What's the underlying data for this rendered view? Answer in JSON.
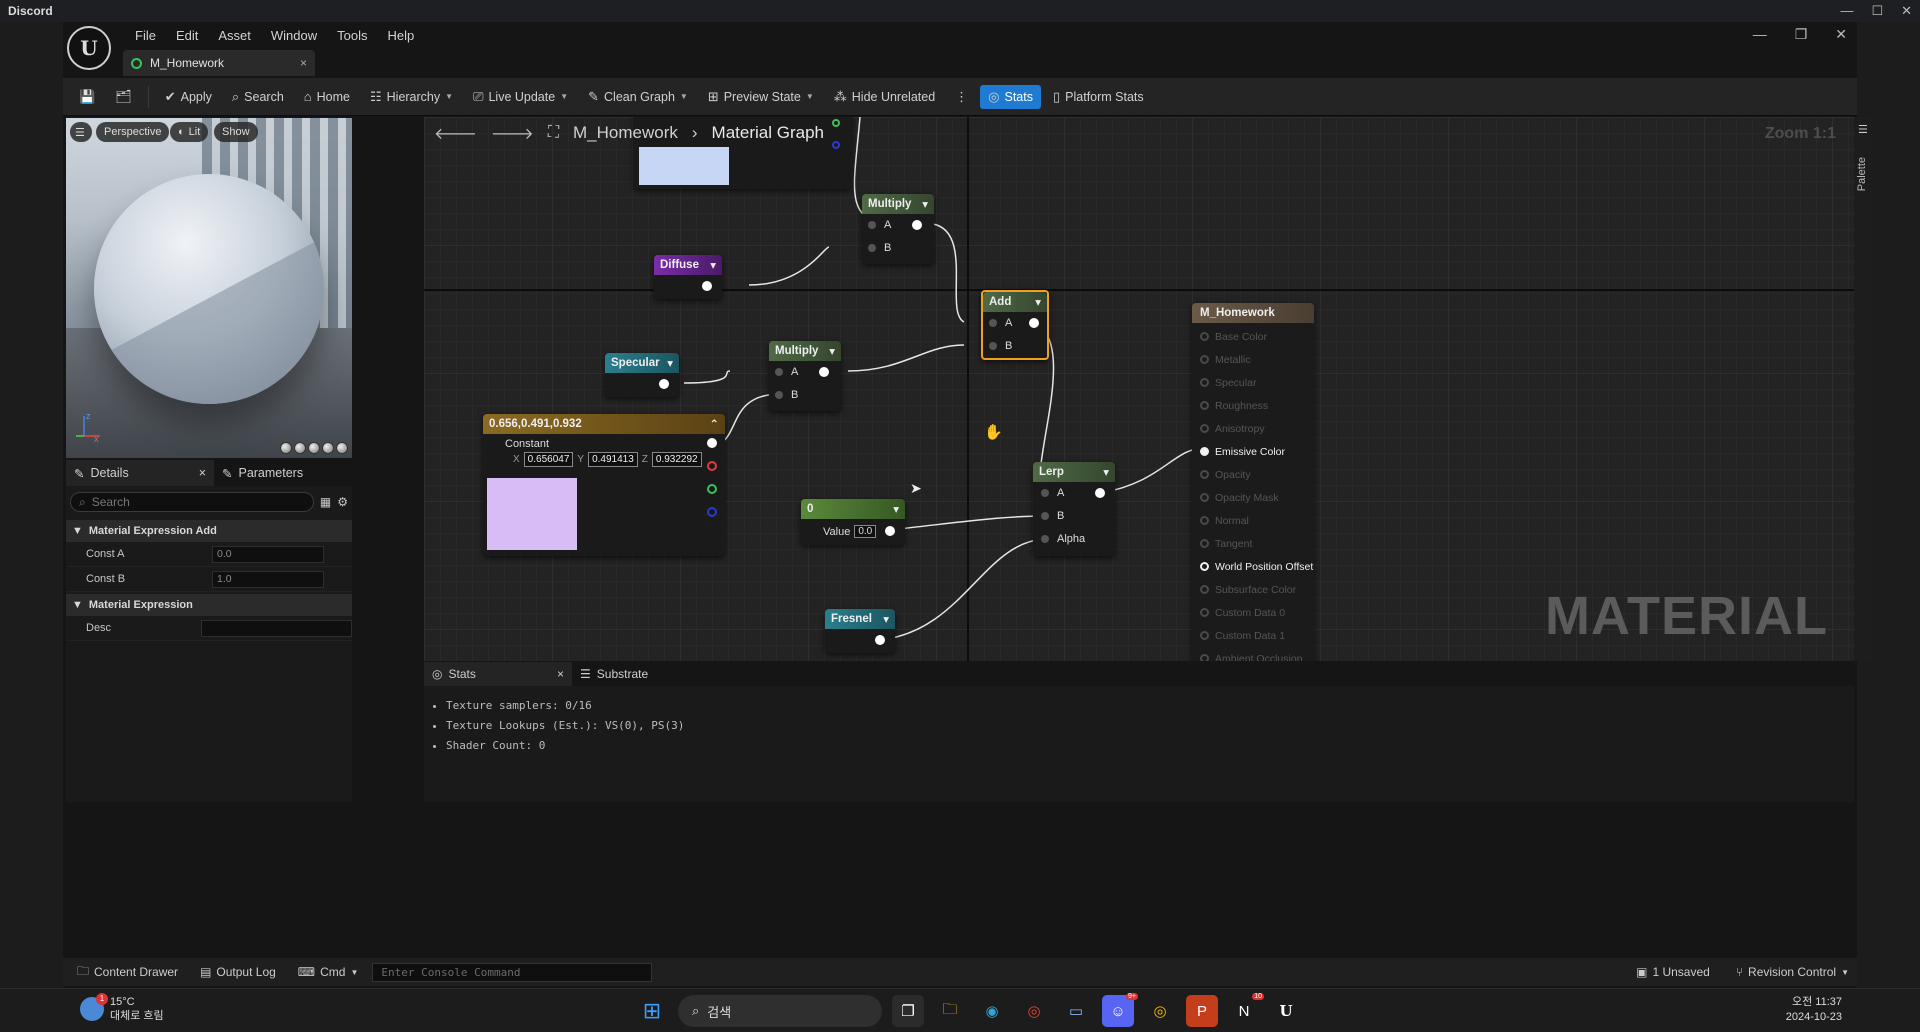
{
  "outer_window": {
    "title": "Discord",
    "controls": [
      "—",
      "☐",
      "✕"
    ]
  },
  "menu": {
    "items": [
      "File",
      "Edit",
      "Asset",
      "Window",
      "Tools",
      "Help"
    ]
  },
  "doc_tab": {
    "label": "M_Homework",
    "close": "×"
  },
  "app_controls": [
    "—",
    "❐",
    "✕"
  ],
  "toolbar": {
    "apply": "Apply",
    "search": "Search",
    "home": "Home",
    "hierarchy": "Hierarchy",
    "live_update": "Live Update",
    "clean_graph": "Clean Graph",
    "preview_state": "Preview State",
    "hide_unrelated": "Hide Unrelated",
    "stats": "Stats",
    "platform_stats": "Platform Stats"
  },
  "viewport": {
    "perspective": "Perspective",
    "lit": "Lit",
    "show": "Show",
    "axis_z": "Z",
    "axis_x": "X",
    "axis_y": "Y"
  },
  "details": {
    "tab_details": "Details",
    "tab_close": "×",
    "tab_parameters": "Parameters",
    "search_placeholder": "Search",
    "section1": "Material Expression Add",
    "const_a_label": "Const A",
    "const_a_value": "0.0",
    "const_b_label": "Const B",
    "const_b_value": "1.0",
    "section2": "Material Expression",
    "desc_label": "Desc",
    "desc_value": ""
  },
  "graph": {
    "breadcrumb_root": "M_Homework",
    "breadcrumb_sep": "›",
    "breadcrumb_current": "Material Graph",
    "zoom": "Zoom 1:1",
    "watermark": "MATERIAL",
    "palette": "Palette"
  },
  "nodes": {
    "multiply1": {
      "title": "Multiply",
      "a": "A",
      "b": "B"
    },
    "diffuse": {
      "title": "Diffuse"
    },
    "add": {
      "title": "Add",
      "a": "A",
      "b": "B"
    },
    "specular": {
      "title": "Specular"
    },
    "multiply2": {
      "title": "Multiply",
      "a": "A",
      "b": "B"
    },
    "constant3": {
      "title": "0.656,0.491,0.932",
      "label": "Constant",
      "x_label": "X",
      "x": "0.656047",
      "y_label": "Y",
      "y": "0.491413",
      "z_label": "Z",
      "z": "0.932292",
      "swatch_color": "#d8bcf6"
    },
    "const0": {
      "title": "0",
      "value_label": "Value",
      "value": "0.0"
    },
    "lerp": {
      "title": "Lerp",
      "a": "A",
      "b": "B",
      "alpha": "Alpha"
    },
    "fresnel": {
      "title": "Fresnel"
    },
    "result": {
      "title": "M_Homework",
      "pins": [
        "Base Color",
        "Metallic",
        "Specular",
        "Roughness",
        "Anisotropy",
        "Emissive Color",
        "Opacity",
        "Opacity Mask",
        "Normal",
        "Tangent",
        "World Position Offset",
        "Subsurface Color",
        "Custom Data 0",
        "Custom Data 1",
        "Ambient Occlusion"
      ],
      "active_pins": [
        "Emissive Color",
        "World Position Offset"
      ]
    }
  },
  "stats": {
    "tab_stats": "Stats",
    "tab_close": "×",
    "tab_substrate": "Substrate",
    "lines": [
      "Texture samplers: 0/16",
      "Texture Lookups (Est.): VS(0), PS(3)",
      "Shader Count: 0"
    ]
  },
  "statusbar": {
    "content_drawer": "Content Drawer",
    "output_log": "Output Log",
    "cmd": "Cmd",
    "console_placeholder": "Enter Console Command",
    "unsaved": "1 Unsaved",
    "revision": "Revision Control"
  },
  "taskbar": {
    "temp": "15°C",
    "weather": "대체로 흐림",
    "weather_badge": "1",
    "search": "검색",
    "time": "오전 11:37",
    "date": "2024-10-23",
    "notion_badge": "10",
    "discord_badge": "9+"
  },
  "colors": {
    "accent": "#1f7ad1",
    "add_outline": "#f0a020"
  }
}
